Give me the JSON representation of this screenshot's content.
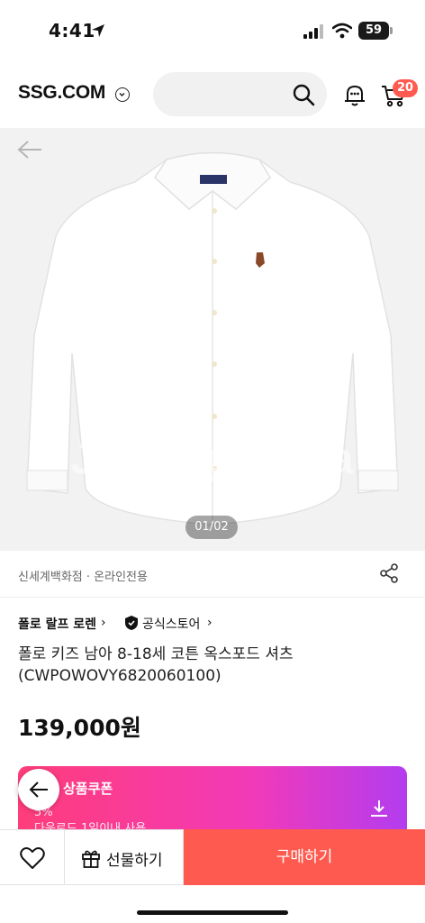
{
  "status_bar": {
    "time": "4:41",
    "battery": "59"
  },
  "header": {
    "logo": "SSG.COM",
    "search": {
      "placeholder": ""
    },
    "cart_count": "20"
  },
  "product_image": {
    "watermark": "Joonggonara",
    "page_indicator": "01/02"
  },
  "seller": {
    "text": "신세계백화점 · 온라인전용"
  },
  "brand": {
    "name": "폴로 랄프 로렌",
    "store": "공식스토어"
  },
  "product": {
    "title": "폴로 키즈 남아 8-18세 코튼 옥스포드 셔츠 (CWPOWOVY6820060100)",
    "price": "139,000원"
  },
  "coupon": {
    "title": "상품쿠폰",
    "discount": "5%",
    "description": "다운로드 1일이내 사용"
  },
  "bottom_bar": {
    "gift_label": "선물하기",
    "buy_label": "구매하기"
  },
  "colors": {
    "accent": "#ff5a4f",
    "coupon_gradient_start": "#ff3d7a",
    "coupon_gradient_end": "#b33cf0"
  },
  "icons": [
    "location-arrow-icon",
    "signal-icon",
    "wifi-icon",
    "chevron-down-icon",
    "search-icon",
    "bell-icon",
    "cart-icon",
    "back-arrow-icon",
    "share-icon",
    "shield-icon",
    "download-icon",
    "heart-icon",
    "gift-icon"
  ]
}
